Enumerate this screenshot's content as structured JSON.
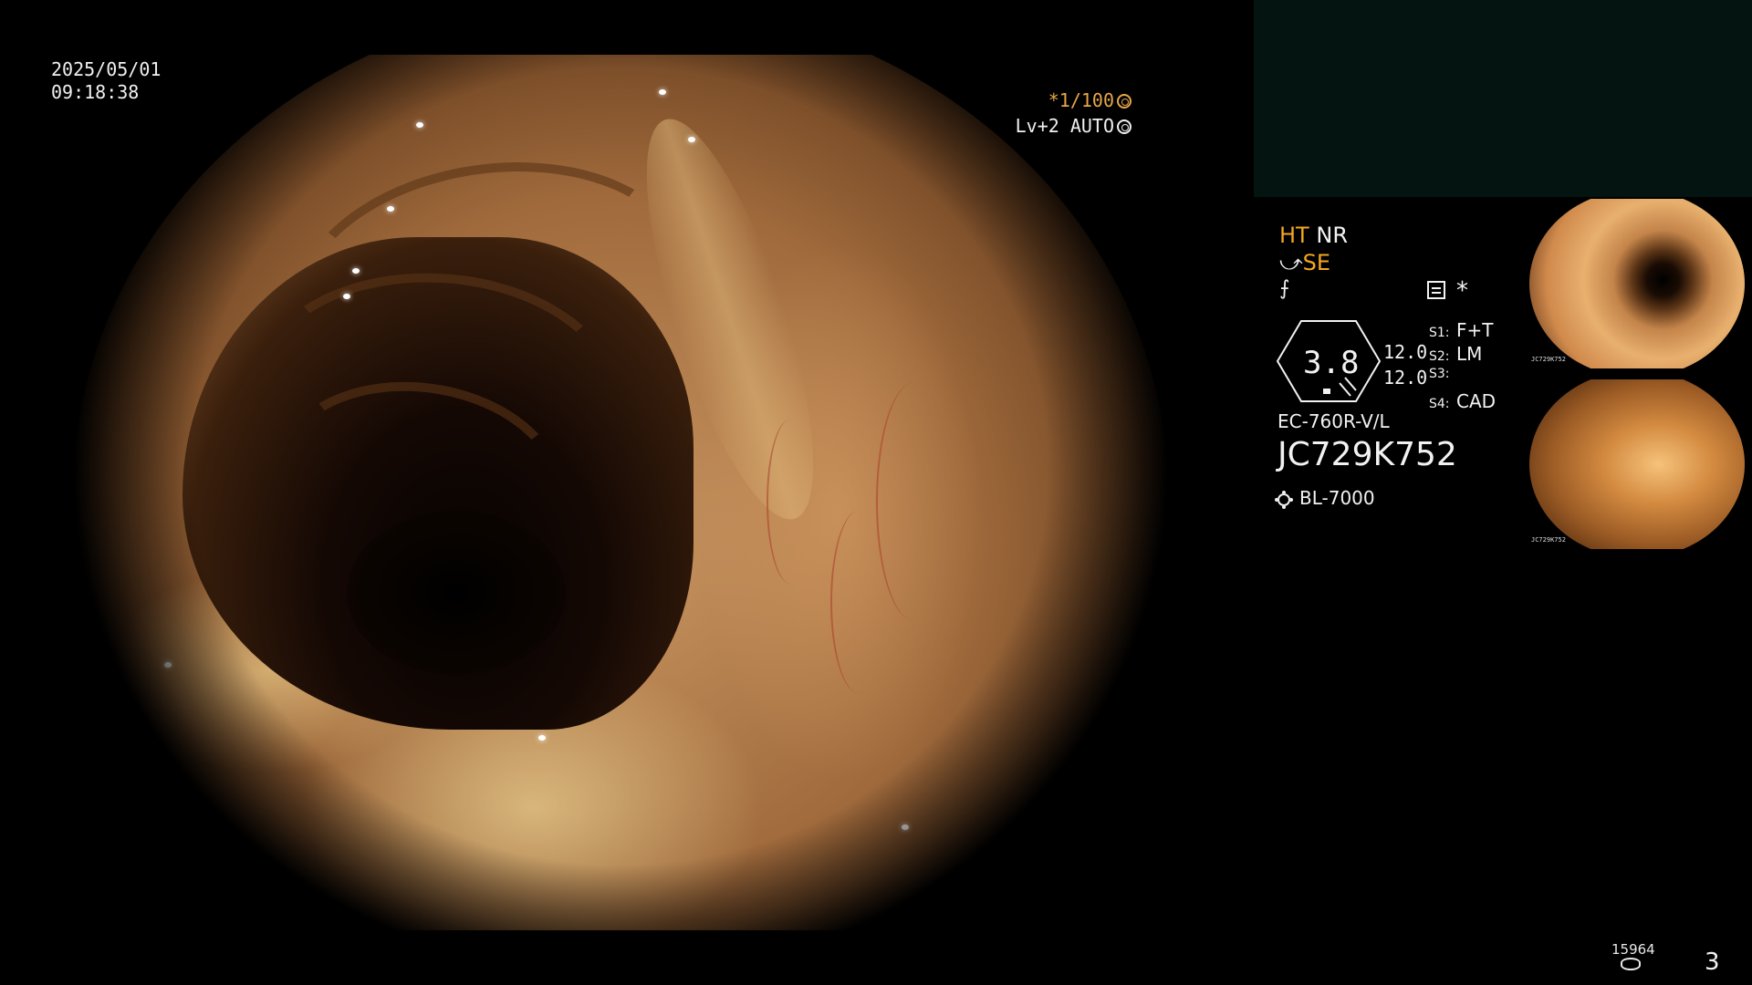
{
  "overlay": {
    "date": "2025/05/01",
    "time": "09:18:38",
    "shutter": "*1/100",
    "level": "Lv+2 AUTO"
  },
  "status": {
    "ht": "HT",
    "nr": "NR",
    "se": "SE",
    "zoom": "3.8",
    "zoom_small_1": "12.0",
    "zoom_small_2": "12.0",
    "star": "*",
    "switches": [
      {
        "key": "S1:",
        "value": "F+T"
      },
      {
        "key": "S2:",
        "value": "LM"
      },
      {
        "key": "S3:",
        "value": ""
      },
      {
        "key": "S4:",
        "value": "CAD"
      }
    ],
    "scope_model": "EC-760R-V/L",
    "serial": "JC729K752",
    "light_source": "BL-7000"
  },
  "thumbnails": [
    {
      "label": "JC729K752"
    },
    {
      "label": "JC729K752"
    }
  ],
  "footer": {
    "counter": "15964",
    "page": "3"
  },
  "colors": {
    "accent_orange": "#f5a623",
    "panel_dark": "#041410"
  }
}
